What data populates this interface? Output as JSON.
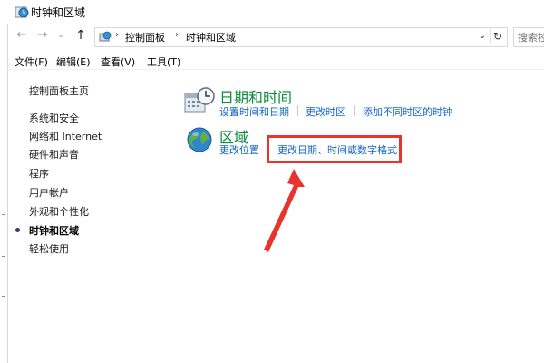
{
  "window": {
    "title": "时钟和区域"
  },
  "address_bar": {
    "breadcrumbs": [
      "控制面板",
      "时钟和区域"
    ],
    "search_placeholder": "搜索控"
  },
  "menu": {
    "items": [
      "文件(F)",
      "编辑(E)",
      "查看(V)",
      "工具(T)"
    ]
  },
  "sidebar": {
    "home": "控制面板主页",
    "items": [
      "系统和安全",
      "网络和 Internet",
      "硬件和声音",
      "程序",
      "用户帐户",
      "外观和个性化",
      "时钟和区域",
      "轻松使用"
    ],
    "current_index": 6
  },
  "categories": {
    "datetime": {
      "title": "日期和时间",
      "links": [
        "设置时间和日期",
        "更改时区",
        "添加不同时区的时钟"
      ]
    },
    "region": {
      "title": "区域",
      "links": [
        "更改位置",
        "更改日期、时间或数字格式"
      ]
    }
  },
  "annotation": {
    "highlight_color": "#e8342d",
    "target": "更改日期、时间或数字格式"
  },
  "colors": {
    "category_title": "#0a8a3b",
    "link": "#1565c8"
  }
}
